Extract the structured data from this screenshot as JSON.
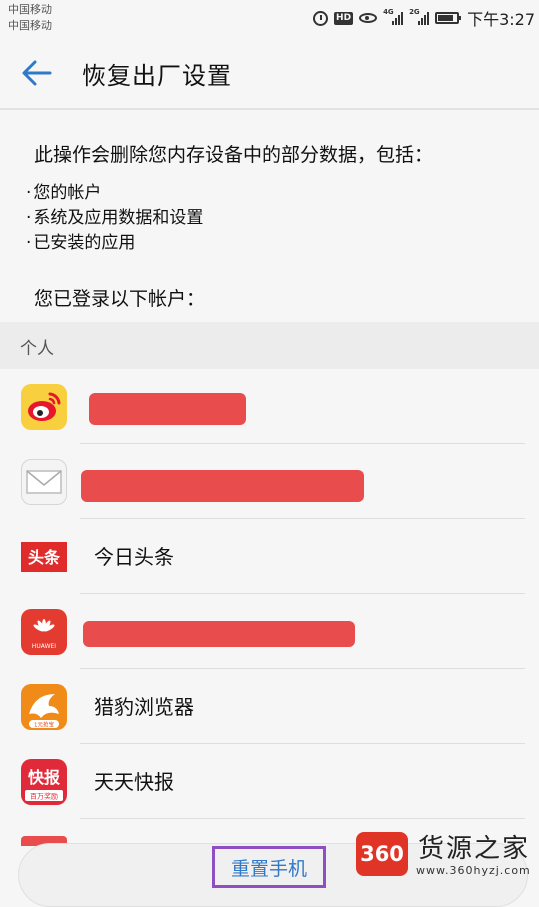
{
  "status_bar": {
    "carrier_1": "中国移动",
    "carrier_2": "中国移动",
    "hd": "HD",
    "signal_1": "4G",
    "signal_2": "2G",
    "time": "下午3:27"
  },
  "header": {
    "title": "恢复出厂设置",
    "accent_color": "#2f79c8"
  },
  "description": {
    "text": "此操作会删除您内存设备中的部分数据，包括：",
    "bullets": [
      "您的帐户",
      "系统及应用数据和设置",
      "已安装的应用"
    ],
    "accounts_label": "您已登录以下帐户："
  },
  "section": {
    "title": "个人"
  },
  "accounts": [
    {
      "icon": "weibo-icon",
      "label": "",
      "redacted": true
    },
    {
      "icon": "email-icon",
      "label": "",
      "redacted": true
    },
    {
      "icon": "toutiao-icon",
      "label": "今日头条",
      "icon_text": "头条",
      "redacted": false
    },
    {
      "icon": "huawei-icon",
      "label": "",
      "icon_text": "HUAWEI",
      "redacted": true
    },
    {
      "icon": "cheetah-browser-icon",
      "label": "猎豹浏览器",
      "icon_text": "1元抢宝",
      "redacted": false
    },
    {
      "icon": "kuaibao-icon",
      "label": "天天快报",
      "icon_text": "快报",
      "icon_subtext": "百万奖励",
      "redacted": false
    }
  ],
  "bottom": {
    "reset_label": "重置手机"
  },
  "watermark": {
    "badge": "360",
    "title": "货源之家",
    "url": "www.360hyzj.com"
  }
}
